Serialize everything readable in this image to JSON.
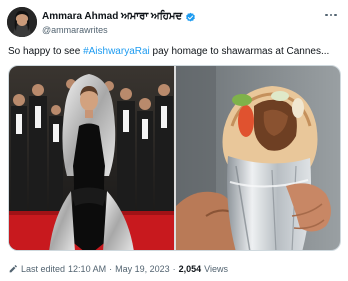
{
  "tweet": {
    "display_name": "Ammara Ahmad ਅਮਾਰਾ ਅਹਿਮਦ",
    "handle": "@ammarawrites",
    "text_before": "So happy to see ",
    "hashtag": "#AishwaryaRai",
    "text_after": " pay homage to shawarmas at Cannes..."
  },
  "meta": {
    "edited_label": "Last edited",
    "time": "12:10 AM",
    "separator": "·",
    "date": "May 19, 2023",
    "views_count": "2,054",
    "views_label": "Views"
  },
  "icons": {
    "verified": "verified-badge-icon",
    "more": "more-options-icon",
    "edited": "pencil-icon"
  },
  "colors": {
    "accent": "#1d9bf0",
    "text": "#0f1419",
    "muted": "#536471"
  }
}
